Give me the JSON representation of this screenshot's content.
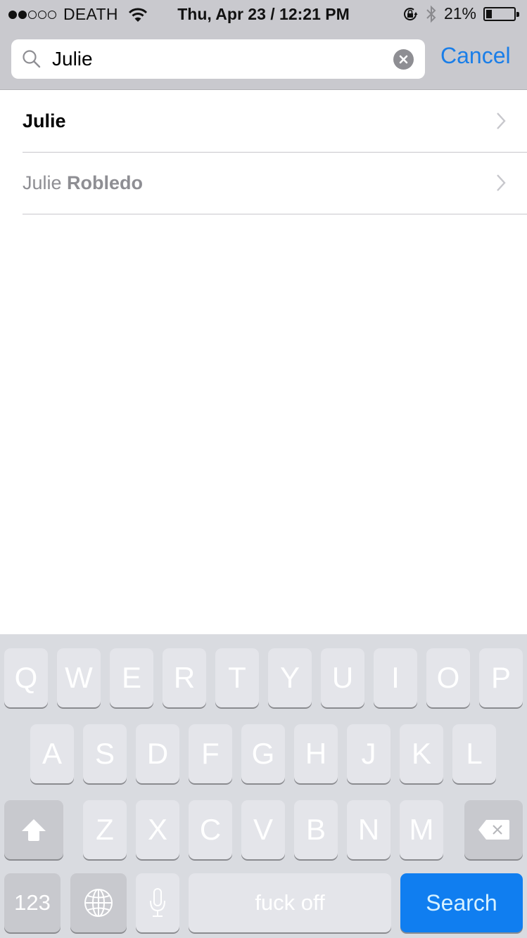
{
  "status_bar": {
    "signal_filled": 2,
    "signal_total": 5,
    "carrier": "DEATH",
    "datetime": "Thu, Apr 23 / 12:21 PM",
    "battery_percent_label": "21%",
    "battery_level": 0.21,
    "icons": [
      "wifi-icon",
      "rotation-lock-icon",
      "bluetooth-icon",
      "battery-icon"
    ]
  },
  "search": {
    "value": "Julie",
    "placeholder": "",
    "cancel_label": "Cancel",
    "accent_color": "#1a7ee8"
  },
  "results": [
    {
      "first": "Julie",
      "last": ""
    },
    {
      "first": "Julie",
      "last": "Robledo"
    }
  ],
  "keyboard": {
    "row1": [
      "Q",
      "W",
      "E",
      "R",
      "T",
      "Y",
      "U",
      "I",
      "O",
      "P"
    ],
    "row2": [
      "A",
      "S",
      "D",
      "F",
      "G",
      "H",
      "J",
      "K",
      "L"
    ],
    "row3": [
      "Z",
      "X",
      "C",
      "V",
      "B",
      "N",
      "M"
    ],
    "numbers_label": "123",
    "space_label": "fuck off",
    "return_label": "Search",
    "return_color": "#107ef0"
  }
}
